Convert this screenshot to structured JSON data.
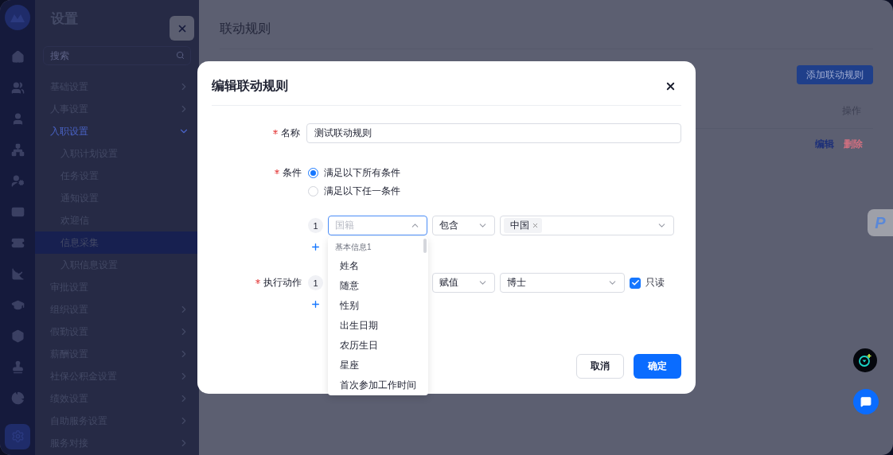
{
  "rail": {
    "items": [
      {
        "selected": false
      },
      {
        "selected": false
      },
      {
        "selected": false
      },
      {
        "selected": false
      },
      {
        "selected": false
      },
      {
        "selected": false
      },
      {
        "selected": false
      },
      {
        "selected": false
      },
      {
        "selected": false
      },
      {
        "selected": false
      },
      {
        "selected": false
      },
      {
        "selected": false
      },
      {
        "selected": true
      }
    ]
  },
  "settings": {
    "title": "设置",
    "search": {
      "placeholder": "搜索"
    },
    "items": [
      {
        "label": "基础设置",
        "kind": "folder",
        "expanded": false,
        "selected": false
      },
      {
        "label": "人事设置",
        "kind": "folder",
        "expanded": false,
        "selected": false
      },
      {
        "label": "入职设置",
        "kind": "folder",
        "expanded": true,
        "selected": true,
        "children": [
          {
            "label": "入职计划设置",
            "selected": false
          },
          {
            "label": "任务设置",
            "selected": false
          },
          {
            "label": "通知设置",
            "selected": false
          },
          {
            "label": "欢迎信",
            "selected": false
          },
          {
            "label": "信息采集",
            "selected": true
          },
          {
            "label": "入职信息设置",
            "selected": false
          }
        ]
      },
      {
        "label": "审批设置",
        "kind": "link",
        "selected": false
      },
      {
        "label": "组织设置",
        "kind": "folder",
        "expanded": false,
        "selected": false
      },
      {
        "label": "假勤设置",
        "kind": "folder",
        "expanded": false,
        "selected": false
      },
      {
        "label": "薪酬设置",
        "kind": "folder",
        "expanded": false,
        "selected": false
      },
      {
        "label": "社保公积金设置",
        "kind": "folder",
        "expanded": false,
        "selected": false
      },
      {
        "label": "绩效设置",
        "kind": "folder",
        "expanded": false,
        "selected": false
      },
      {
        "label": "自助服务设置",
        "kind": "folder",
        "expanded": false,
        "selected": false
      },
      {
        "label": "服务对接",
        "kind": "folder",
        "expanded": false,
        "selected": false
      }
    ]
  },
  "main": {
    "title": "联动规则",
    "add_button": "添加联动规则",
    "table": {
      "columns": [
        "操作"
      ],
      "rows": [
        {
          "actions": [
            {
              "label": "编辑",
              "kind": "edit"
            },
            {
              "label": "删除",
              "kind": "danger"
            }
          ]
        }
      ]
    },
    "floating_badge": "P"
  },
  "dialog": {
    "title": "编辑联动规则",
    "name_field": {
      "label": "名称",
      "required": true,
      "value": "测试联动规则"
    },
    "condition": {
      "label": "条件",
      "required": true,
      "options": [
        {
          "label": "满足以下所有条件",
          "selected": true
        },
        {
          "label": "满足以下任一条件",
          "selected": false
        }
      ],
      "rules": [
        {
          "index": "1",
          "field": {
            "placeholder": "国籍",
            "open": true
          },
          "operator": "包含",
          "values": [
            {
              "label": "中国"
            }
          ]
        }
      ]
    },
    "dropdown": {
      "group": "基本信息1",
      "options": [
        "姓名",
        "随意",
        "性别",
        "出生日期",
        "农历生日",
        "星座",
        "首次参加工作时间"
      ]
    },
    "action": {
      "label": "执行动作",
      "required": true,
      "rows": [
        {
          "index": "1",
          "operator": "赋值",
          "value": "博士",
          "readonly": {
            "label": "只读",
            "checked": true
          }
        }
      ]
    },
    "buttons": [
      {
        "label": "取消",
        "kind": "secondary"
      },
      {
        "label": "确定",
        "kind": "primary"
      }
    ]
  }
}
